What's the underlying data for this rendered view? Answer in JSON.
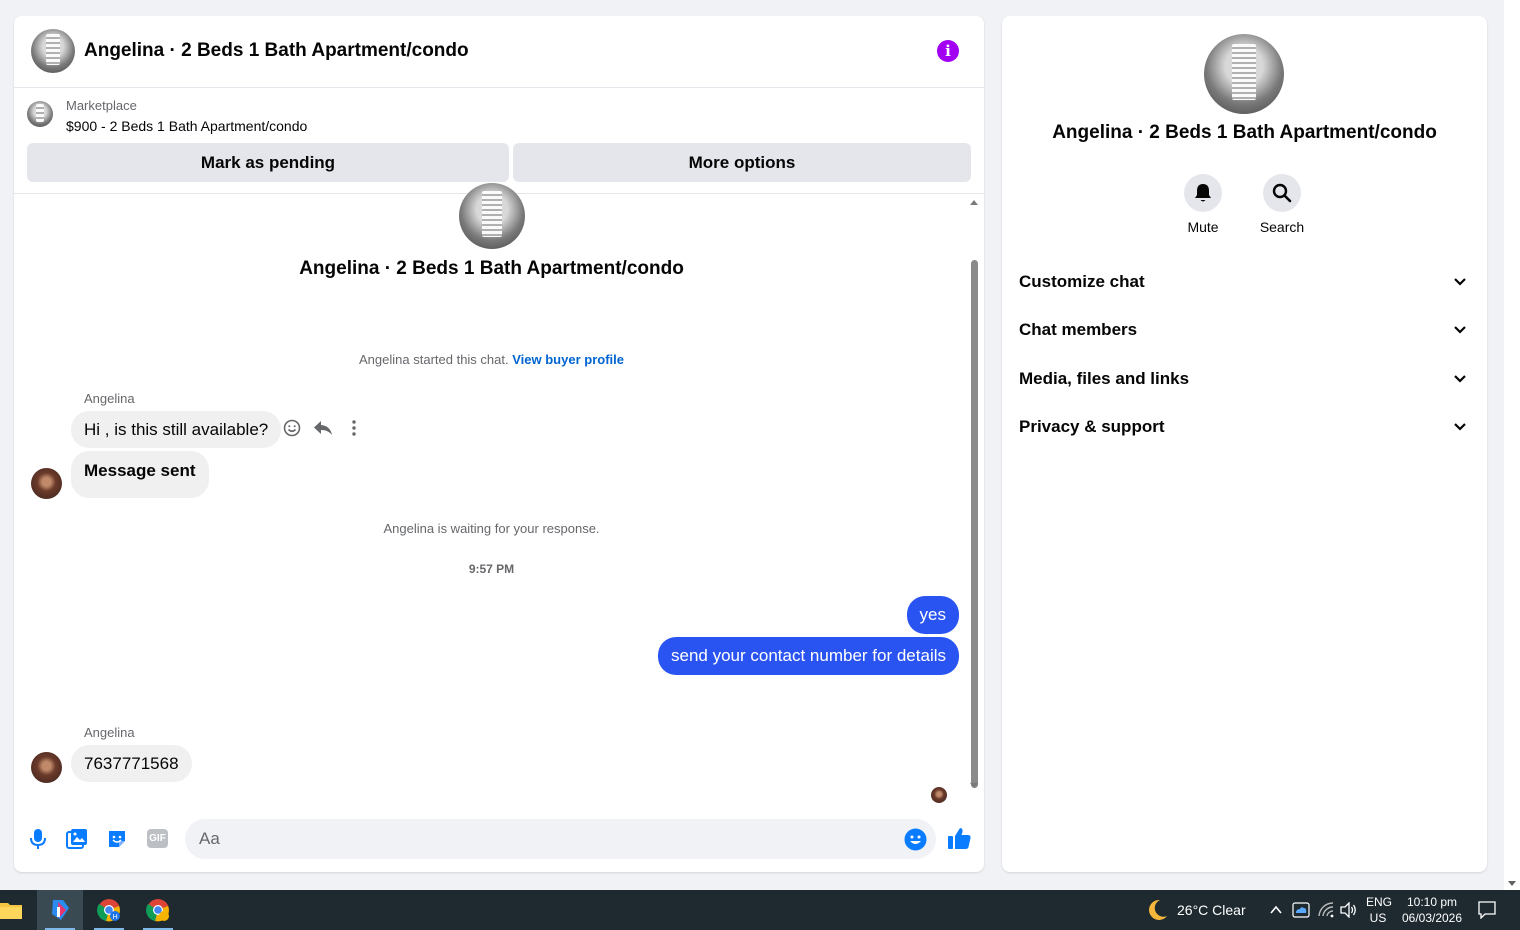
{
  "chat": {
    "title": "Angelina · 2 Beds 1 Bath Apartment/condo",
    "marketplace_label": "Marketplace",
    "listing": "$900 - 2 Beds 1 Bath Apartment/condo",
    "mark_pending": "Mark as pending",
    "more_options": "More options",
    "conversation_title": "Angelina · 2 Beds 1 Bath Apartment/condo",
    "started_text": "Angelina started this chat.",
    "view_buyer": "View buyer profile",
    "sender_1": "Angelina",
    "msg_1": "Hi , is this still available?",
    "msg_2": "Message sent",
    "waiting": "Angelina is waiting for your response.",
    "timestamp": "9:57 PM",
    "out_1": "yes",
    "out_2": "send your contact number for details",
    "sender_2": "Angelina",
    "msg_3": "7637771568",
    "composer_placeholder": "Aa",
    "gif_label": "GIF"
  },
  "side": {
    "title": "Angelina · 2 Beds 1 Bath Apartment/condo",
    "mute": "Mute",
    "search": "Search",
    "sections": [
      "Customize chat",
      "Chat members",
      "Media, files and links",
      "Privacy & support"
    ]
  },
  "taskbar": {
    "weather": "26°C  Clear",
    "lang_1": "ENG",
    "lang_2": "US",
    "time": "10:10 pm",
    "date": "06/03/2026"
  },
  "colors": {
    "accent": "#0084ff",
    "outgoing_bubble": "#2a54f2",
    "info": "#a100f2",
    "link": "#0064d1"
  }
}
